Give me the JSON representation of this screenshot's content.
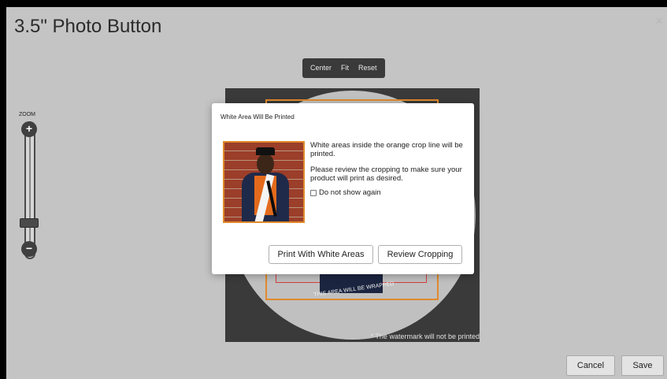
{
  "editor": {
    "title": "3.5\" Photo Button",
    "close_icon": "✕",
    "toolbar": {
      "center": "Center",
      "fit": "Fit",
      "reset": "Reset"
    },
    "zoom": {
      "label": "ZOOM",
      "plus": "+",
      "minus": "−"
    },
    "canvas": {
      "wrap_text": "THIS AREA WILL BE WRAPPED",
      "watermark": "* The watermark will not be printed"
    },
    "footer": {
      "cancel": "Cancel",
      "save": "Save"
    }
  },
  "modal": {
    "title": "White Area Will Be Printed",
    "message_1": "White areas inside the orange crop line will be printed.",
    "message_2": "Please review the cropping to make sure your product will print as desired.",
    "checkbox_label": "Do not show again",
    "print_button": "Print With White Areas",
    "review_button": "Review Cropping"
  },
  "colors": {
    "crop_orange": "#e08a2c",
    "crop_red": "#d43b3b",
    "overlay_gray": "#c4c4c4"
  }
}
